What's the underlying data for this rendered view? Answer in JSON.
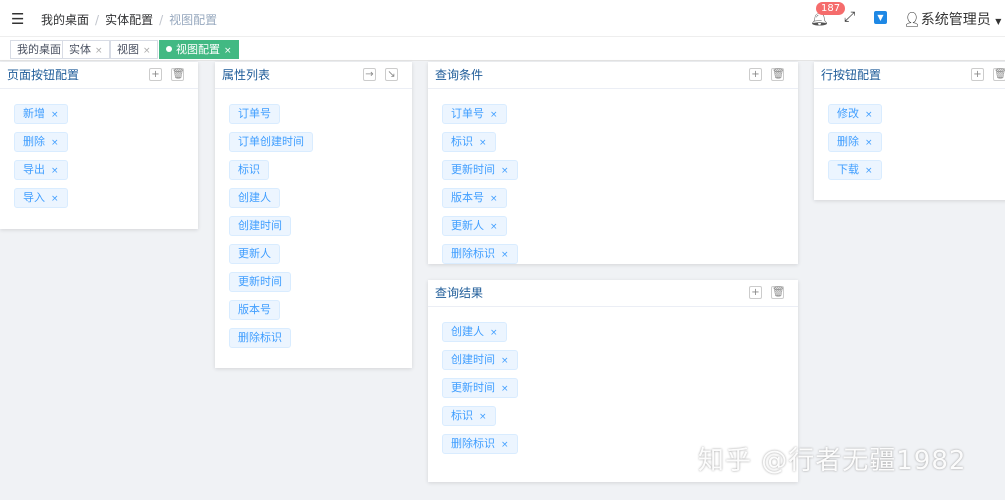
{
  "header": {
    "menu_icon": "hamburger-icon",
    "breadcrumb": [
      "我的桌面",
      "实体配置",
      "视图配置"
    ],
    "notification_count": "187",
    "user": "系统管理员"
  },
  "tabs": [
    {
      "label": "我的桌面",
      "closable": false
    },
    {
      "label": "实体",
      "closable": true
    },
    {
      "label": "视图",
      "closable": true
    },
    {
      "label": "视图配置",
      "closable": true,
      "active": true
    }
  ],
  "panels": [
    {
      "title": "页面按钮配置",
      "actions": [
        "plus-icon",
        "trash-icon"
      ],
      "tags": [
        "新增",
        "删除",
        "导出",
        "导入"
      ],
      "closable": true
    },
    {
      "title": "属性列表",
      "actions": [
        "arrow-right-icon",
        "arrow-down-right-icon"
      ],
      "tags": [
        "订单号",
        "订单创建时间",
        "标识",
        "创建人",
        "创建时间",
        "更新人",
        "更新时间",
        "版本号",
        "删除标识"
      ],
      "closable": false
    },
    {
      "title": "查询条件",
      "actions": [
        "plus-icon",
        "trash-icon"
      ],
      "tags": [
        "订单号",
        "标识",
        "更新时间",
        "版本号",
        "更新人",
        "删除标识"
      ],
      "closable": true
    },
    {
      "title": "查询结果",
      "actions": [
        "plus-icon",
        "trash-icon"
      ],
      "tags": [
        "创建人",
        "创建时间",
        "更新时间",
        "标识",
        "删除标识"
      ],
      "closable": true
    },
    {
      "title": "行按钮配置",
      "actions": [
        "plus-icon",
        "trash-icon"
      ],
      "tags": [
        "修改",
        "删除",
        "下载"
      ],
      "closable": true
    }
  ],
  "watermark": "知乎 @行者无疆1982"
}
